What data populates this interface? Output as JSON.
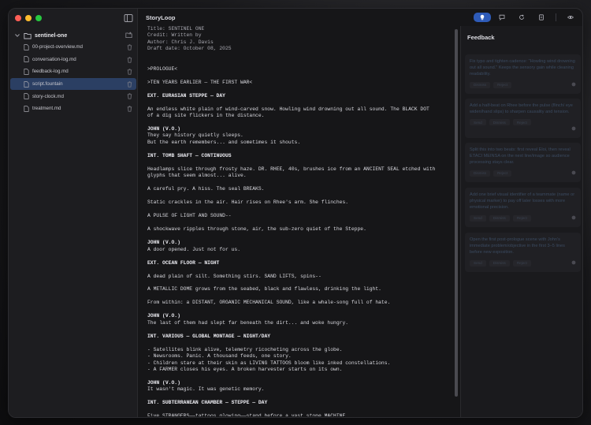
{
  "app": {
    "title": "StoryLoop"
  },
  "sidebar": {
    "folder": "sentinel-one",
    "files": [
      {
        "name": "00-project-overview.md",
        "active": false
      },
      {
        "name": "conversation-log.md",
        "active": false
      },
      {
        "name": "feedback-log.md",
        "active": false
      },
      {
        "name": "script.fountain",
        "active": true
      },
      {
        "name": "story-clock.md",
        "active": false
      },
      {
        "name": "treatment.md",
        "active": false
      }
    ]
  },
  "toolbar": {
    "buttons": [
      {
        "icon": "lightbulb-icon",
        "active": true
      },
      {
        "icon": "chat-bubble-icon",
        "active": false
      },
      {
        "icon": "refresh-icon",
        "active": false
      },
      {
        "icon": "notes-icon",
        "active": false
      },
      {
        "icon": "eye-icon",
        "active": false
      }
    ]
  },
  "editor": {
    "lines": [
      {
        "t": "Title: SENTINEL ONE",
        "k": "meta"
      },
      {
        "t": "Credit: Written by",
        "k": "meta"
      },
      {
        "t": "Author: Chris J. Davis",
        "k": "meta"
      },
      {
        "t": "Draft date: October 08, 2025",
        "k": "meta"
      },
      {
        "t": "",
        "k": "gap"
      },
      {
        "t": "",
        "k": "gap"
      },
      {
        "t": ">PROLOGUE<",
        "k": "text"
      },
      {
        "t": "",
        "k": "gap"
      },
      {
        "t": ">TEN YEARS EARLIER — THE FIRST WAR<",
        "k": "text"
      },
      {
        "t": "",
        "k": "gap"
      },
      {
        "t": "EXT. EURASIAN STEPPE — DAY",
        "k": "heading"
      },
      {
        "t": "",
        "k": "gap"
      },
      {
        "t": "An endless white plain of wind-carved snow. Howling wind drowning out all sound. The BLACK DOT",
        "k": "text"
      },
      {
        "t": "of a dig site flickers in the distance.",
        "k": "text"
      },
      {
        "t": "",
        "k": "gap"
      },
      {
        "t": "JOHN (V.O.)",
        "k": "heading"
      },
      {
        "t": "They say history quietly sleeps.",
        "k": "text"
      },
      {
        "t": "But the earth remembers... and sometimes it shouts.",
        "k": "text"
      },
      {
        "t": "",
        "k": "gap"
      },
      {
        "t": "INT. TOMB SHAFT — CONTINUOUS",
        "k": "heading"
      },
      {
        "t": "",
        "k": "gap"
      },
      {
        "t": "Headlamps slice through frosty haze. DR. RHEE, 40s, brushes ice from an ANCIENT SEAL etched with",
        "k": "text"
      },
      {
        "t": "glyphs that seem almost... alive.",
        "k": "text"
      },
      {
        "t": "",
        "k": "gap"
      },
      {
        "t": "A careful pry. A hiss. The seal BREAKS.",
        "k": "text"
      },
      {
        "t": "",
        "k": "gap"
      },
      {
        "t": "Static crackles in the air. Hair rises on Rhee's arm. She flinches.",
        "k": "text"
      },
      {
        "t": "",
        "k": "gap"
      },
      {
        "t": "A PULSE OF LIGHT AND SOUND--",
        "k": "text"
      },
      {
        "t": "",
        "k": "gap"
      },
      {
        "t": "A shockwave ripples through stone, air, the sub-zero quiet of the Steppe.",
        "k": "text"
      },
      {
        "t": "",
        "k": "gap"
      },
      {
        "t": "JOHN (V.O.)",
        "k": "heading"
      },
      {
        "t": "A door opened. Just not for us.",
        "k": "text"
      },
      {
        "t": "",
        "k": "gap"
      },
      {
        "t": "EXT. OCEAN FLOOR — NIGHT",
        "k": "heading"
      },
      {
        "t": "",
        "k": "gap"
      },
      {
        "t": "A dead plain of silt. Something stirs. SAND LIFTS, spins--",
        "k": "text"
      },
      {
        "t": "",
        "k": "gap"
      },
      {
        "t": "A METALLIC DOME grows from the seabed, black and flawless, drinking the light.",
        "k": "text"
      },
      {
        "t": "",
        "k": "gap"
      },
      {
        "t": "From within: a DISTANT, ORGANIC MECHANICAL SOUND, like a whale-song full of hate.",
        "k": "text"
      },
      {
        "t": "",
        "k": "gap"
      },
      {
        "t": "JOHN (V.O.)",
        "k": "heading"
      },
      {
        "t": "The last of them had slept far beneath the dirt... and woke hungry.",
        "k": "text"
      },
      {
        "t": "",
        "k": "gap"
      },
      {
        "t": "INT. VARIOUS — GLOBAL MONTAGE — NIGHT/DAY",
        "k": "heading"
      },
      {
        "t": "",
        "k": "gap"
      },
      {
        "t": "- Satellites blink alive, telemetry ricocheting across the globe.",
        "k": "text"
      },
      {
        "t": "- Newsrooms. Panic. A thousand feeds, one story.",
        "k": "text"
      },
      {
        "t": "- Children stare at their skin as LIVING TATTOOS bloom like inked constellations.",
        "k": "text"
      },
      {
        "t": "- A FARMER closes his eyes. A broken harvester starts on its own.",
        "k": "text"
      },
      {
        "t": "",
        "k": "gap"
      },
      {
        "t": "JOHN (V.O.)",
        "k": "heading"
      },
      {
        "t": "It wasn't magic. It was genetic memory.",
        "k": "text"
      },
      {
        "t": "",
        "k": "gap"
      },
      {
        "t": "INT. SUBTERRANEAN CHAMBER — STEPPE — DAY",
        "k": "heading"
      },
      {
        "t": "",
        "k": "gap"
      },
      {
        "t": "Five STRANGERS——tattoos glowing——stand before a vast stone MACHINE.",
        "k": "text"
      }
    ]
  },
  "feedback": {
    "title": "Feedback",
    "cards": [
      {
        "text": "Fix typo and tighten cadence: \"Howling wind drowning out all sound.\" Keeps the sensory gain while cleaning readability.",
        "actions": [
          "Dismiss",
          "Reject"
        ]
      },
      {
        "text": "Add a half-beat on Rhee before the pulse (flinch/ eye widen/hand slips) to sharpen causality and tension.",
        "actions": [
          "Send",
          "Dismiss",
          "Reject"
        ]
      },
      {
        "text": "Split this into two beats: first reveal Eloi, then reveal ETACI MEINSA on the next line/image so audience processing stays clear.",
        "actions": [
          "Dismiss",
          "Reject"
        ]
      },
      {
        "text": "Add one brief visual identifier of a teammate (name or physical marker) to pay off later losses with more emotional precision.",
        "actions": [
          "Send",
          "Dismiss",
          "Reject"
        ]
      },
      {
        "text": "Open the first post-prologue scene with John's immediate problem/objective in the first 3–5 lines before new exposition.",
        "actions": [
          "Send",
          "Dismiss",
          "Reject"
        ]
      }
    ]
  }
}
